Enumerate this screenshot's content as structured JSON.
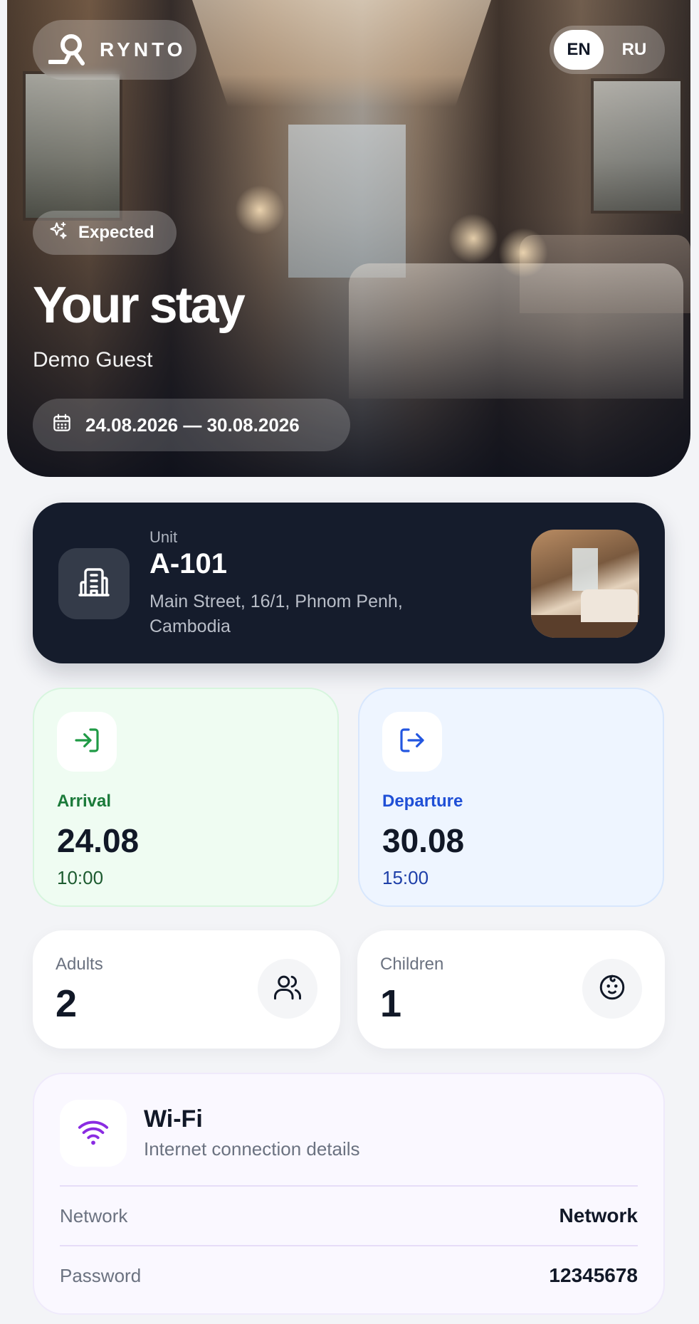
{
  "brand": {
    "name": "RYNTO",
    "logo_icon": "rynto-logo-icon"
  },
  "language": {
    "options": [
      "EN",
      "RU"
    ],
    "selected": "EN"
  },
  "hero": {
    "status": "Expected",
    "status_icon": "sparkles-icon",
    "title": "Your stay",
    "guest_name": "Demo Guest",
    "dates": "24.08.2026 — 30.08.2026",
    "dates_icon": "calendar-icon"
  },
  "unit": {
    "label": "Unit",
    "name": "A-101",
    "address": "Main Street, 16/1, Phnom Penh, Cambodia",
    "icon": "building-icon"
  },
  "arrival": {
    "label": "Arrival",
    "date": "24.08",
    "time": "10:00",
    "icon": "log-in-icon",
    "color": "#1b7a3a"
  },
  "departure": {
    "label": "Departure",
    "date": "30.08",
    "time": "15:00",
    "icon": "log-out-icon",
    "color": "#1f4fd6"
  },
  "guests": {
    "adults": {
      "label": "Adults",
      "count": "2",
      "icon": "users-icon"
    },
    "children": {
      "label": "Children",
      "count": "1",
      "icon": "baby-icon"
    }
  },
  "wifi": {
    "title": "Wi-Fi",
    "subtitle": "Internet connection details",
    "icon": "wifi-icon",
    "accent": "#8a2be2",
    "rows": [
      {
        "label": "Network",
        "value": "Network"
      },
      {
        "label": "Password",
        "value": "12345678"
      }
    ]
  }
}
